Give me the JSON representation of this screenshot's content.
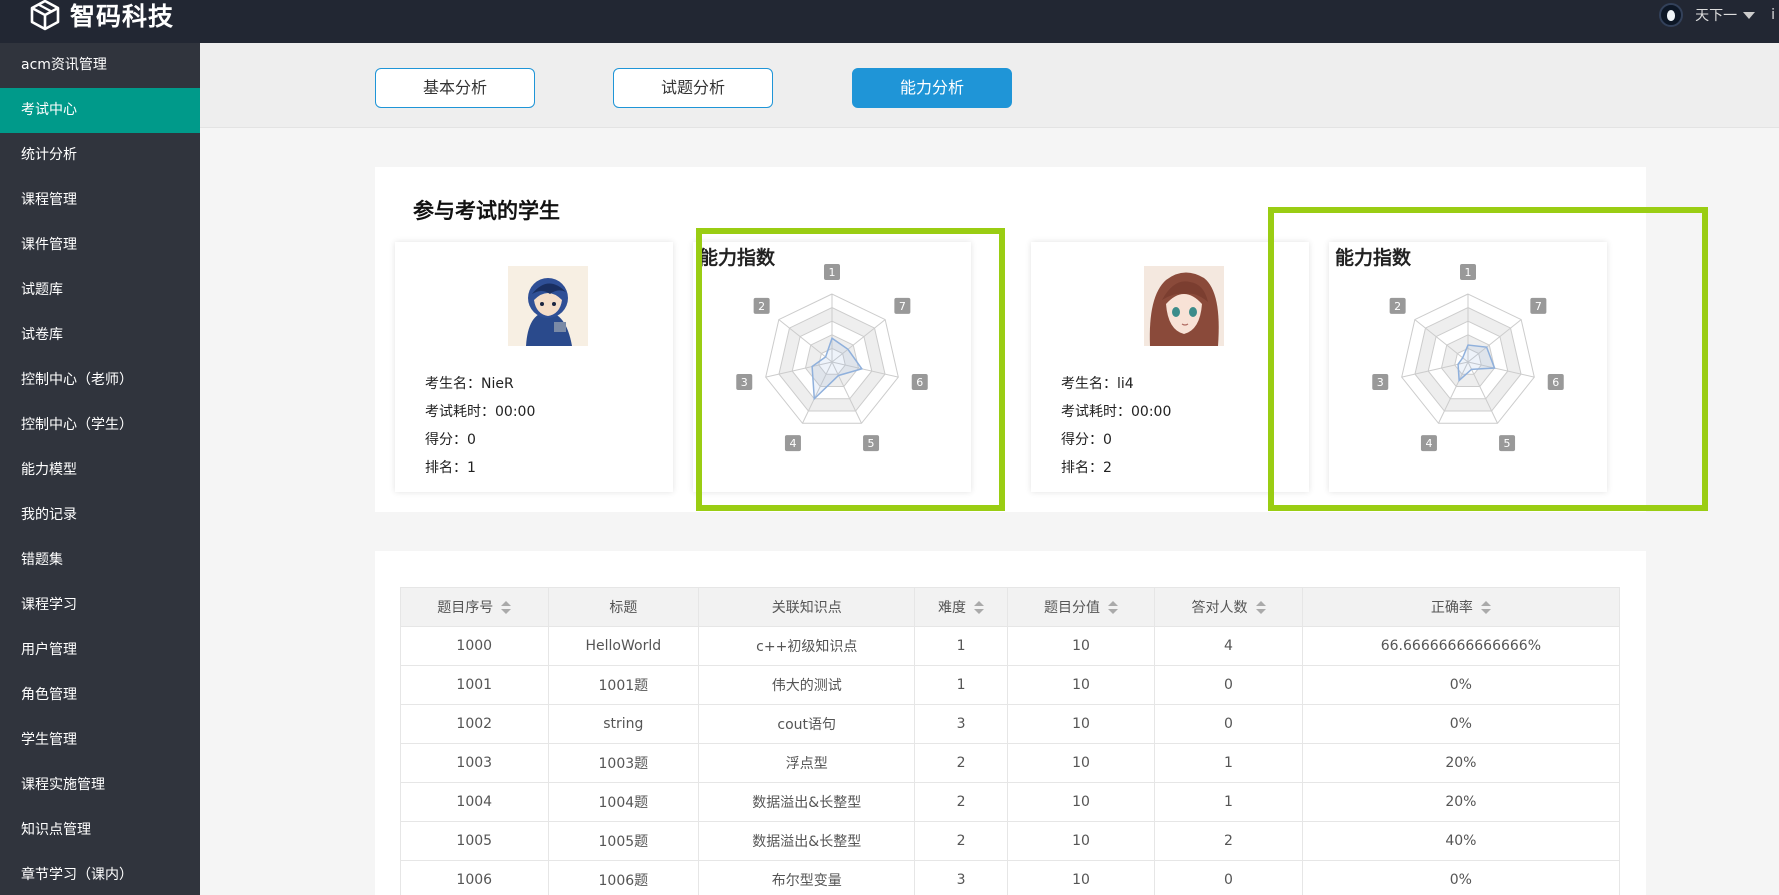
{
  "brand": {
    "name": "智码科技"
  },
  "user": {
    "name": "天下一",
    "trail": "i"
  },
  "sidebar": {
    "items": [
      {
        "label": "acm资讯管理"
      },
      {
        "label": "考试中心"
      },
      {
        "label": "统计分析"
      },
      {
        "label": "课程管理"
      },
      {
        "label": "课件管理"
      },
      {
        "label": "试题库"
      },
      {
        "label": "试卷库"
      },
      {
        "label": "控制中心（老师）"
      },
      {
        "label": "控制中心（学生）"
      },
      {
        "label": "能力模型"
      },
      {
        "label": "我的记录"
      },
      {
        "label": "错题集"
      },
      {
        "label": "课程学习"
      },
      {
        "label": "用户管理"
      },
      {
        "label": "角色管理"
      },
      {
        "label": "学生管理"
      },
      {
        "label": "课程实施管理"
      },
      {
        "label": "知识点管理"
      },
      {
        "label": "章节学习（课内）"
      }
    ]
  },
  "tabs": [
    {
      "label": "基本分析"
    },
    {
      "label": "试题分析"
    },
    {
      "label": "能力分析"
    }
  ],
  "students_section": {
    "title": "参与考试的学生",
    "students": [
      {
        "name_label": "考生名：NieR",
        "time_label": "考试耗时：00:00",
        "score_label": "得分：0",
        "rank_label": "排名：1"
      },
      {
        "name_label": "考生名：li4",
        "time_label": "考试耗时：00:00",
        "score_label": "得分：0",
        "rank_label": "排名：2"
      }
    ],
    "radar": {
      "title": "能力指数",
      "axes": [
        "1",
        "2",
        "3",
        "4",
        "5",
        "6",
        "7"
      ]
    }
  },
  "table": {
    "columns": [
      "题目序号",
      "标题",
      "关联知识点",
      "难度",
      "题目分值",
      "答对人数",
      "正确率"
    ],
    "sortable": [
      true,
      false,
      false,
      true,
      true,
      true,
      true
    ],
    "rows": [
      [
        "1000",
        "HelloWorld",
        "c++初级知识点",
        "1",
        "10",
        "4",
        "66.66666666666666%"
      ],
      [
        "1001",
        "1001题",
        "伟大的测试",
        "1",
        "10",
        "0",
        "0%"
      ],
      [
        "1002",
        "string",
        "cout语句",
        "3",
        "10",
        "0",
        "0%"
      ],
      [
        "1003",
        "1003题",
        "浮点型",
        "2",
        "10",
        "1",
        "20%"
      ],
      [
        "1004",
        "1004题",
        "数据溢出&长整型",
        "2",
        "10",
        "1",
        "20%"
      ],
      [
        "1005",
        "1005题",
        "数据溢出&长整型",
        "2",
        "10",
        "2",
        "40%"
      ],
      [
        "1006",
        "1006题",
        "布尔型变量",
        "3",
        "10",
        "0",
        "0%"
      ]
    ]
  }
}
